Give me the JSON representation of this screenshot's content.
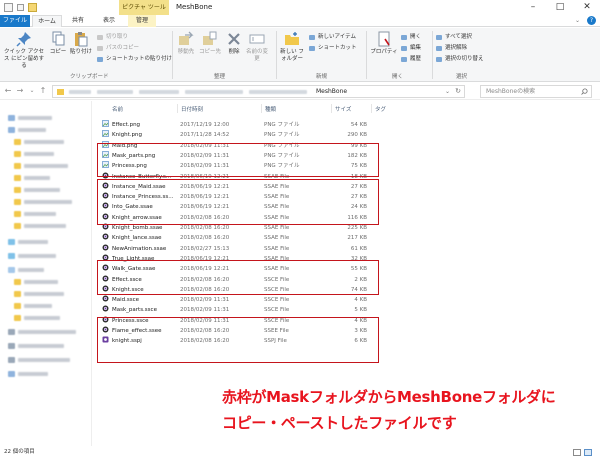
{
  "window": {
    "title": "MeshBone",
    "contextual_tab": "ピクチャ ツール",
    "controls": [
      "–",
      "□",
      "✕"
    ]
  },
  "tabs": [
    "ファイル",
    "ホーム",
    "共有",
    "表示",
    "管理"
  ],
  "ribbon": {
    "clipboard": {
      "pin_label": "クイック アクセス にピン留めする",
      "copy_label": "コピー",
      "paste_label": "貼り付け",
      "cut_label": "切り取り",
      "copy_path_label": "パスのコピー",
      "paste_shortcut_label": "ショートカットの貼り付け",
      "group_label": "クリップボード"
    },
    "organize": {
      "move_label": "移動先",
      "copyto_label": "コピー先",
      "delete_label": "削除",
      "rename_label": "名前の変更",
      "group_label": "整理"
    },
    "new": {
      "folder_label": "新しい フォルダー",
      "new_item_label": "新しいアイテム",
      "easy_access_label": "ショートカット",
      "group_label": "新規"
    },
    "open": {
      "properties_label": "プロパティ",
      "open_label": "開く",
      "edit_label": "編集",
      "history_label": "履歴",
      "group_label": "開く"
    },
    "select": {
      "all_label": "すべて選択",
      "none_label": "選択解除",
      "invert_label": "選択の切り替え",
      "group_label": "選択"
    }
  },
  "address": {
    "current_folder": "MeshBone",
    "search_placeholder": "MeshBoneの検索"
  },
  "columns": {
    "name": "名前",
    "date": "日付時刻",
    "type": "種類",
    "size": "サイズ",
    "tags": "タグ"
  },
  "files": [
    {
      "name": "Effect.png",
      "date": "2017/12/19 12:00",
      "type": "PNG ファイル",
      "size": "54 KB",
      "kind": "png"
    },
    {
      "name": "Knight.png",
      "date": "2017/11/28 14:52",
      "type": "PNG ファイル",
      "size": "290 KB",
      "kind": "png"
    },
    {
      "name": "Maid.png",
      "date": "2018/02/09 11:31",
      "type": "PNG ファイル",
      "size": "99 KB",
      "kind": "png"
    },
    {
      "name": "Mask_parts.png",
      "date": "2018/02/09 11:31",
      "type": "PNG ファイル",
      "size": "182 KB",
      "kind": "png"
    },
    {
      "name": "Princess.png",
      "date": "2018/02/09 11:31",
      "type": "PNG ファイル",
      "size": "75 KB",
      "kind": "png"
    },
    {
      "name": "Instance_Butterfly.s...",
      "date": "2018/06/19 12:21",
      "type": "SSAE File",
      "size": "18 KB",
      "kind": "ss"
    },
    {
      "name": "Instance_Maid.ssae",
      "date": "2018/06/19 12:21",
      "type": "SSAE File",
      "size": "27 KB",
      "kind": "ss"
    },
    {
      "name": "Instance_Princess.ss...",
      "date": "2018/06/19 12:21",
      "type": "SSAE File",
      "size": "27 KB",
      "kind": "ss"
    },
    {
      "name": "Into_Gate.ssae",
      "date": "2018/06/19 12:21",
      "type": "SSAE File",
      "size": "24 KB",
      "kind": "ss"
    },
    {
      "name": "Knight_arrow.ssae",
      "date": "2018/02/08 16:20",
      "type": "SSAE File",
      "size": "116 KB",
      "kind": "ss"
    },
    {
      "name": "Knight_bomb.ssae",
      "date": "2018/02/08 16:20",
      "type": "SSAE File",
      "size": "225 KB",
      "kind": "ss"
    },
    {
      "name": "Knight_lance.ssae",
      "date": "2018/02/08 16:20",
      "type": "SSAE File",
      "size": "217 KB",
      "kind": "ss"
    },
    {
      "name": "NewAnimation.ssae",
      "date": "2018/02/27 15:13",
      "type": "SSAE File",
      "size": "61 KB",
      "kind": "ss"
    },
    {
      "name": "True_Light.ssae",
      "date": "2018/06/19 12:21",
      "type": "SSAE File",
      "size": "32 KB",
      "kind": "ss"
    },
    {
      "name": "Walk_Gate.ssae",
      "date": "2018/06/19 12:21",
      "type": "SSAE File",
      "size": "55 KB",
      "kind": "ss"
    },
    {
      "name": "Effect.ssce",
      "date": "2018/02/08 16:20",
      "type": "SSCE File",
      "size": "2 KB",
      "kind": "ss"
    },
    {
      "name": "Knight.ssce",
      "date": "2018/02/08 16:20",
      "type": "SSCE File",
      "size": "74 KB",
      "kind": "ss"
    },
    {
      "name": "Maid.ssce",
      "date": "2018/02/09 11:31",
      "type": "SSCE File",
      "size": "4 KB",
      "kind": "ss"
    },
    {
      "name": "Mask_parts.ssce",
      "date": "2018/02/09 11:31",
      "type": "SSCE File",
      "size": "5 KB",
      "kind": "ss"
    },
    {
      "name": "Princess.ssce",
      "date": "2018/02/09 11:31",
      "type": "SSCE File",
      "size": "4 KB",
      "kind": "ss"
    },
    {
      "name": "Flame_effect.ssee",
      "date": "2018/02/08 16:20",
      "type": "SSEE File",
      "size": "3 KB",
      "kind": "ss"
    },
    {
      "name": "knight.sspj",
      "date": "2018/02/08 16:20",
      "type": "SSPJ File",
      "size": "6 KB",
      "kind": "sspj"
    }
  ],
  "annotation": {
    "line1": "赤枠がMaskフォルダからMeshBoneフォルダに",
    "line2": "コピー・ペーストしたファイルです"
  },
  "status": {
    "item_count": "22 個の項目"
  },
  "colors": {
    "highlight": "#c4151c",
    "annotation": "#e8141e",
    "file_tab": "#1979ca",
    "context_tab": "#f3e08a"
  }
}
